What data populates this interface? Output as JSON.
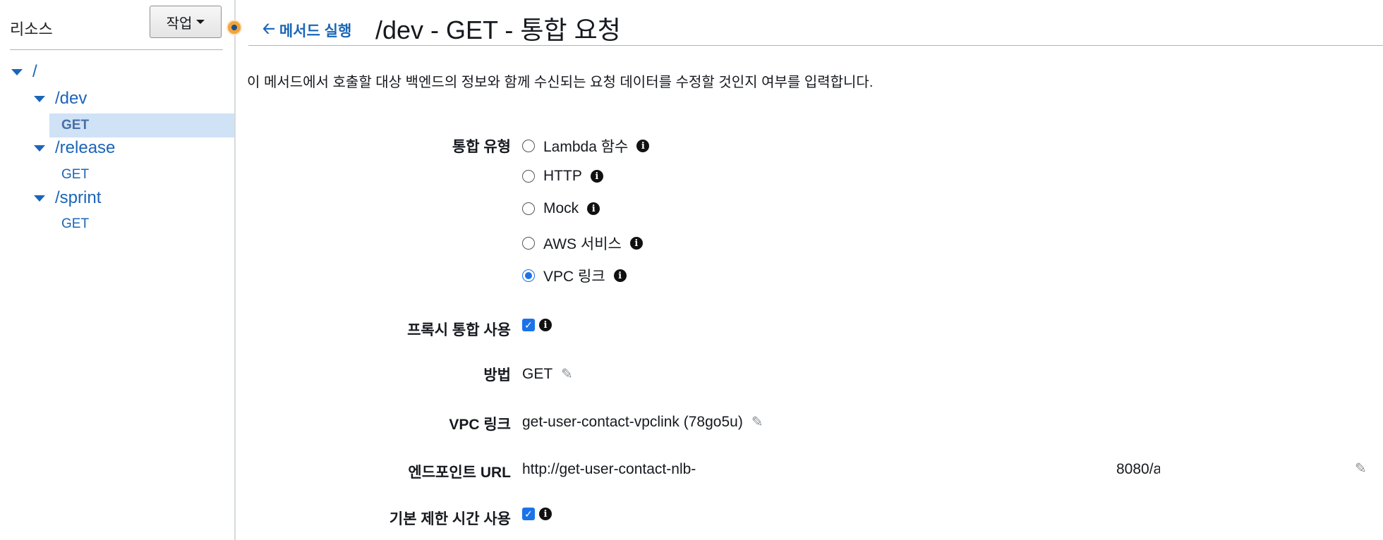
{
  "sidebar": {
    "title": "리소스",
    "action_label": "작업",
    "tree": {
      "root": "/",
      "dev": "/dev",
      "dev_get": "GET",
      "release": "/release",
      "release_get": "GET",
      "sprint": "/sprint",
      "sprint_get": "GET"
    }
  },
  "header": {
    "back_label": "메서드 실행",
    "title": "/dev - GET - 통합 요청"
  },
  "description": "이 메서드에서 호출할 대상 백엔드의 정보와 함께 수신되는 요청 데이터를 수정할 것인지 여부를 입력합니다.",
  "form": {
    "integration_type": {
      "label": "통합 유형",
      "options": [
        "Lambda 함수",
        "HTTP",
        "Mock",
        "AWS 서비스",
        "VPC 링크"
      ],
      "selected": "VPC 링크"
    },
    "proxy": {
      "label": "프록시 통합 사용",
      "checked": true
    },
    "method": {
      "label": "방법",
      "value": "GET"
    },
    "vpc_link": {
      "label": "VPC 링크",
      "value": "get-user-contact-vpclink (78go5u)"
    },
    "endpoint_url": {
      "label": "엔드포인트 URL",
      "value_start": "http://get-user-contact-nlb-",
      "value_end": "8080/a"
    },
    "default_timeout": {
      "label": "기본 제한 시간 사용",
      "checked": true
    }
  },
  "colors": {
    "link": "#1a65b8",
    "selected_bg": "#cfe2f6",
    "accent": "#1a73e8"
  }
}
